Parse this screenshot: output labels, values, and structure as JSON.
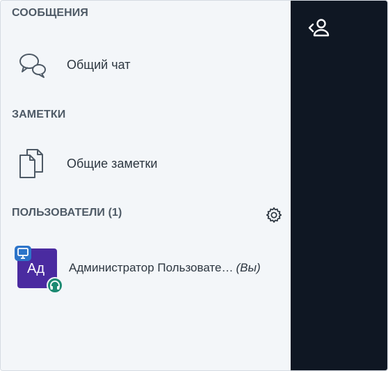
{
  "messages": {
    "title": "СООБЩЕНИЯ",
    "public_chat": {
      "label": "Общий чат",
      "icon": "chat-bubbles-icon"
    }
  },
  "notes": {
    "title": "ЗАМЕТКИ",
    "shared_notes": {
      "label": "Общие заметки",
      "icon": "documents-icon"
    }
  },
  "users": {
    "title": "ПОЛЬЗОВАТЕЛИ (1)",
    "settings_icon": "gear-icon",
    "list": [
      {
        "initials": "Ад",
        "name": "Администратор Пользовате…",
        "you_label": "(Вы)",
        "avatar_color": "#4a2ba0",
        "presenter_badge_color": "#2c74c9",
        "voice_badge_color": "#1c8a72"
      }
    ]
  },
  "toolbar": {
    "toggle_icon": "user-list-toggle-icon"
  }
}
